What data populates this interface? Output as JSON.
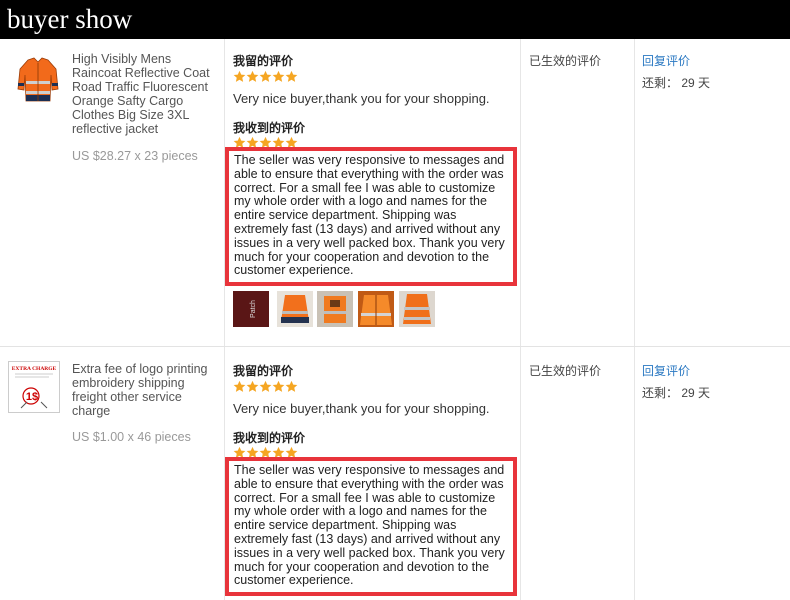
{
  "header": {
    "title": "buyer show"
  },
  "rows": [
    {
      "product_name": "High Visibly Mens Raincoat Reflective Coat Road Traffic Fluorescent Orange Safty Cargo Clothes Big Size 3XL reflective jacket",
      "price": "US $28.27 x 23 pieces",
      "my_review_label": "我留的评价",
      "my_review_text": "Very nice buyer,thank you for your shopping.",
      "received_label": "我收到的评价",
      "received_text": "The seller was very responsive to messages and able to ensure that everything with the order was correct. For a small fee I was able to customize my whole order with a logo and names for the entire service department. Shipping was extremely fast (13 days) and arrived without any issues in a very well packed box. Thank you very much for your cooperation and devotion to the customer experience.",
      "status": "已生效的评价",
      "reply_link": "回复评价",
      "remaining": "还剩： 29 天",
      "my_rating": 5,
      "received_rating": 5,
      "photo_count": 5
    },
    {
      "product_name": "Extra fee of logo printing embroidery shipping freight other service charge",
      "price": "US $1.00 x 46 pieces",
      "my_review_label": "我留的评价",
      "my_review_text": "Very nice buyer,thank you for your shopping.",
      "received_label": "我收到的评价",
      "received_text": "The seller was very responsive to messages and able to ensure that everything with the order was correct. For a small fee I was able to customize my whole order with a logo and names for the entire service department. Shipping was extremely fast (13 days) and arrived without any issues in a very well packed box. Thank you very much for your cooperation and devotion to the customer experience.",
      "status": "已生效的评价",
      "reply_link": "回复评价",
      "remaining": "还剩： 29 天",
      "my_rating": 5,
      "received_rating": 5,
      "thumb_caption": "EXTRA CHARGE",
      "thumb_mark": "1$"
    }
  ],
  "colors": {
    "star": "#f5a623",
    "highlight_border": "#e8343b",
    "link": "#2a78c2"
  }
}
